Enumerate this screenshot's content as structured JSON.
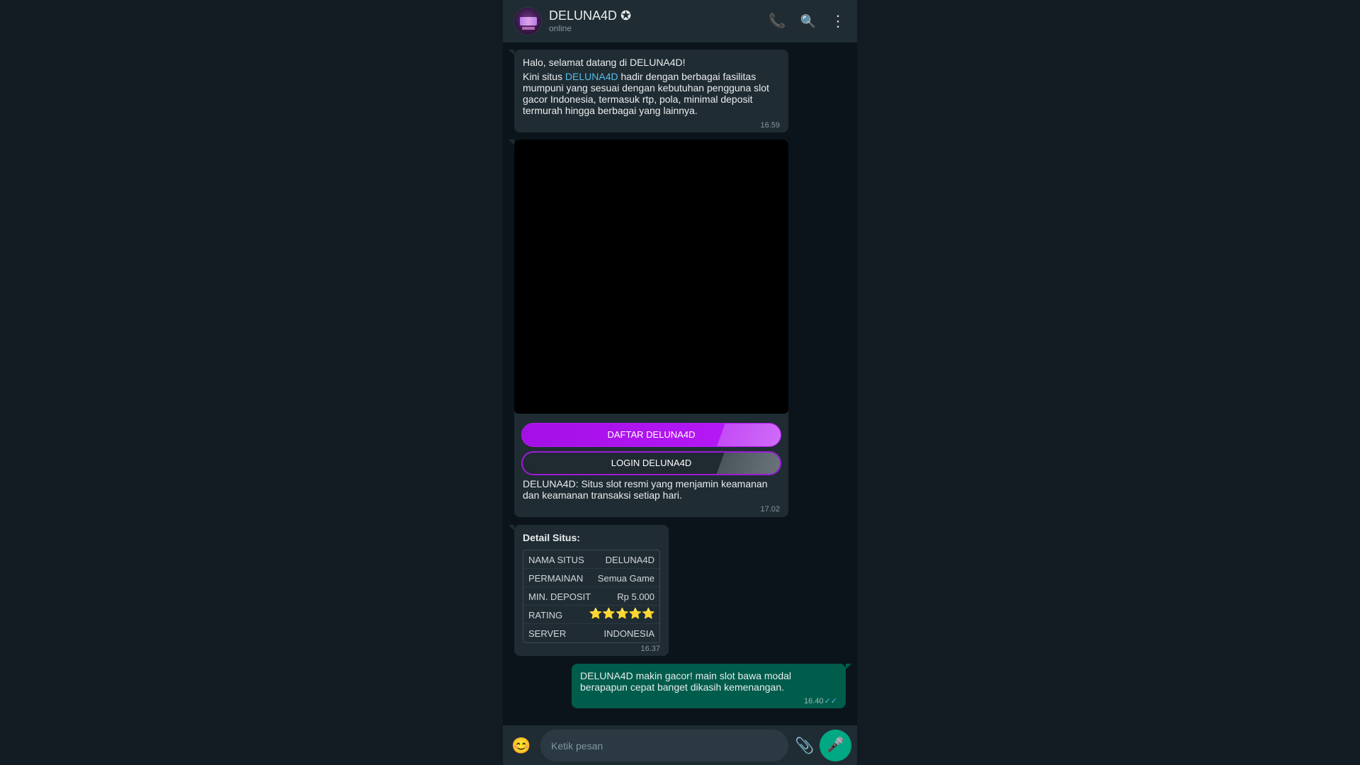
{
  "header": {
    "name": "DELUNA4D",
    "verified_badge": "✪",
    "status": "online"
  },
  "messages": {
    "welcome": {
      "greeting": "Halo, selamat datang di DELUNA4D!",
      "para_prefix": "Kini situs ",
      "para_link": "DELUNA4D",
      "para_suffix": " hadir dengan berbagai fasilitas mumpuni yang sesuai dengan kebutuhan pengguna slot gacor Indonesia, termasuk rtp, pola, minimal deposit termurah hingga berbagai yang lainnya.",
      "time": "16.59"
    },
    "promo": {
      "daftar_label": "DAFTAR DELUNA4D",
      "login_label": "LOGIN DELUNA4D",
      "caption": "DELUNA4D: Situs slot resmi yang menjamin keamanan dan keamanan transaksi setiap hari.",
      "time": "17.02"
    },
    "details": {
      "title": "Detail Situs:",
      "rows": [
        {
          "key": "NAMA SITUS",
          "value": "DELUNA4D"
        },
        {
          "key": "PERMAINAN",
          "value": "Semua Game"
        },
        {
          "key": "MIN. DEPOSIT",
          "value": "Rp 5.000"
        },
        {
          "key": "RATING",
          "value": "⭐⭐⭐⭐⭐"
        },
        {
          "key": "SERVER",
          "value": "INDONESIA"
        }
      ],
      "time": "16.37"
    },
    "outgoing": {
      "text": "DELUNA4D makin gacor! main slot bawa modal berapapun cepat banget dikasih kemenangan.",
      "time": "16.40",
      "ticks": "✓✓"
    }
  },
  "footer": {
    "placeholder": "Ketik pesan"
  },
  "icons": {
    "phone": "📞",
    "search": "🔍",
    "more": "⋮",
    "emoji": "😊",
    "attach": "📎",
    "mic": "🎤"
  },
  "colors": {
    "app_bg": "#111b21",
    "chat_bg": "#0b141a",
    "panel": "#202c33",
    "outgoing_bubble": "#005c4b",
    "accent_purple": "#b418f5",
    "link": "#53bdeb",
    "send_button": "#00a884"
  }
}
